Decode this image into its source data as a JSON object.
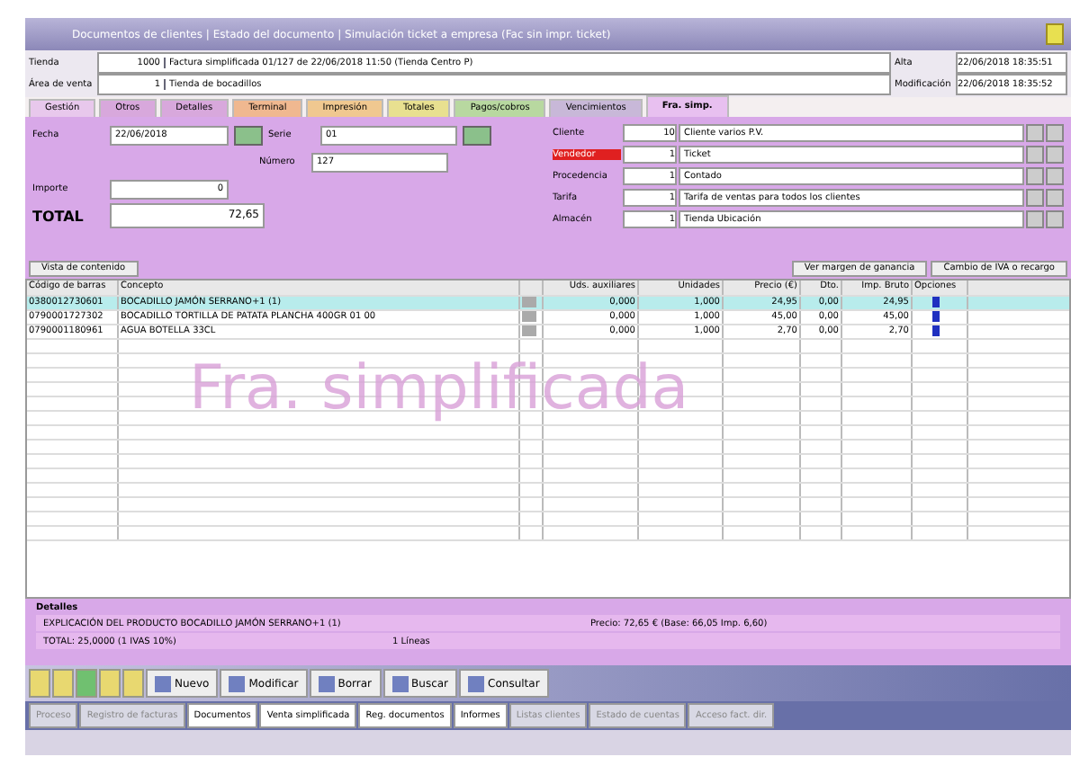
{
  "window": {
    "title": "Documentos de clientes | Estado del documento | Simulación ticket a empresa (Fac sin impr. ticket)"
  },
  "header": {
    "fields": [
      {
        "label": "Tienda",
        "code": "1000",
        "value": "Factura simplificada 01/127 de 22/06/2018 11:50 (Tienda Centro P)",
        "date_label": "Alta",
        "date": "22/06/2018 18:35:51"
      },
      {
        "label": "Área de venta",
        "code": "1",
        "value": "Tienda de bocadillos",
        "date_label": "Modificación",
        "date": "22/06/2018 18:35:52"
      }
    ]
  },
  "tabs": [
    {
      "label": "Gestión",
      "selected": false,
      "color": "#e8c8ec"
    },
    {
      "label": "Otros",
      "selected": false,
      "color": "#d8a8dc"
    },
    {
      "label": "Detalles",
      "selected": false,
      "color": "#d8a8dc"
    },
    {
      "label": "Terminal",
      "selected": false,
      "color": "#f0b890"
    },
    {
      "label": "Impresión",
      "selected": false,
      "color": "#f0c890"
    },
    {
      "label": "Totales",
      "selected": false,
      "color": "#e8e090"
    },
    {
      "label": "Pagos/cobros",
      "selected": false,
      "color": "#b8d8a0"
    },
    {
      "label": "Vencimientos",
      "selected": false,
      "color": "#c8b8d8"
    },
    {
      "label": "Fra. simp.",
      "selected": true,
      "color": "#e8c0f0"
    }
  ],
  "form": {
    "fecha_label": "Fecha",
    "fecha": "22/06/2018",
    "serie_label": "Serie",
    "serie": "01",
    "numero_label": "Número",
    "numero": "127",
    "importe_label": "Importe",
    "importe": "0",
    "total_label": "TOTAL",
    "total": "72,65",
    "refs": [
      {
        "label": "Cliente",
        "code": "10",
        "value": "Cliente varios P.V.",
        "alert": false
      },
      {
        "label": "Vendedor",
        "code": "1",
        "value": "Ticket",
        "alert": true
      },
      {
        "label": "Procedencia",
        "code": "1",
        "value": "Contado",
        "alert": false
      },
      {
        "label": "Tarifa",
        "code": "1",
        "value": "Tarifa de ventas para todos los clientes",
        "alert": false
      },
      {
        "label": "Almacén",
        "code": "1",
        "value": "Tienda Ubicación",
        "alert": false
      }
    ]
  },
  "lines": {
    "view_button": "Vista de contenido",
    "margin_button": "Ver margen de ganancia",
    "iva_button": "Cambio de IVA o recargo",
    "columns": [
      "Código de barras",
      "Concepto",
      "Uds. auxiliares",
      "Unidades",
      "Precio (€)",
      "Dto.",
      "Imp. Bruto",
      "Opciones"
    ],
    "rows": [
      {
        "selected": true,
        "cells": [
          "0380012730601",
          "BOCADILLO JAMÓN SERRANO+1 (1)",
          "0,000",
          "1,000",
          "24,95",
          "0,00",
          "24,95"
        ]
      },
      {
        "selected": false,
        "cells": [
          "0790001727302",
          "BOCADILLO TORTILLA DE PATATA PLANCHA 400GR 01 00",
          "0,000",
          "1,000",
          "45,00",
          "0,00",
          "45,00"
        ]
      },
      {
        "selected": false,
        "cells": [
          "0790001180961",
          "AGUA BOTELLA 33CL",
          "0,000",
          "1,000",
          "2,70",
          "0,00",
          "2,70"
        ]
      }
    ],
    "stamp": "Fra. simplificada"
  },
  "details": {
    "title": "Detalles",
    "line1": "EXPLICACIÓN DEL PRODUCTO BOCADILLO JAMÓN SERRANO+1 (1)",
    "line1_right": "Precio: 72,65 € (Base: 66,05 Imp. 6,60)",
    "line2": "TOTAL: 25,0000 (1 IVAS 10%)",
    "line2_mid": "1 Líneas"
  },
  "toolbar": {
    "buttons": [
      "Nuevo",
      "Modificar",
      "Borrar",
      "Buscar",
      "Consultar"
    ]
  },
  "taskbar": [
    {
      "label": "Proceso",
      "selected": false
    },
    {
      "label": "Registro de facturas",
      "selected": false
    },
    {
      "label": "Documentos",
      "selected": true
    },
    {
      "label": "Venta simplificada",
      "selected": true
    },
    {
      "label": "Reg. documentos",
      "selected": true
    },
    {
      "label": "Informes",
      "selected": true
    },
    {
      "label": "Listas clientes",
      "selected": false
    },
    {
      "label": "Estado de cuentas",
      "selected": false
    },
    {
      "label": "Acceso fact. dir.",
      "selected": false
    }
  ]
}
